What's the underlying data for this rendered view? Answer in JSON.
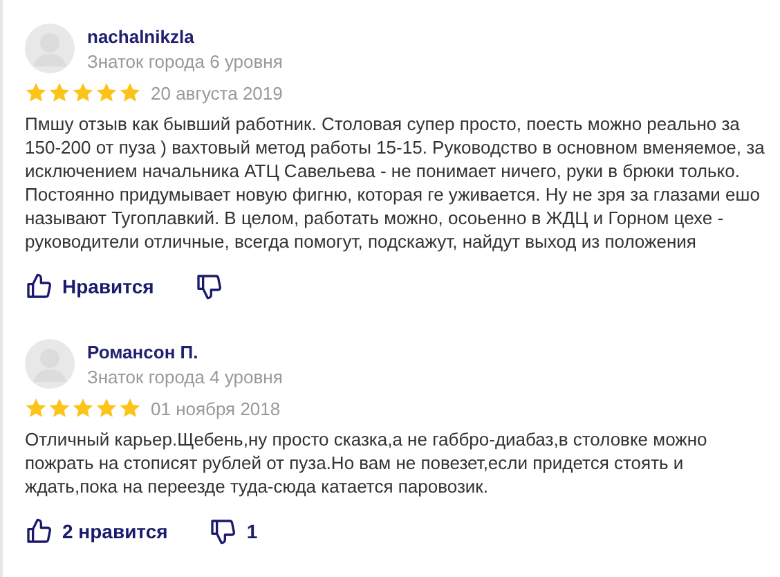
{
  "reviews": [
    {
      "author": "nachalnikzla",
      "level": "Знаток города 6 уровня",
      "stars": 5,
      "date": "20 августа 2019",
      "text": "Пмшу отзыв как бывший работник. Столовая супер просто, поесть можно реально за 150-200 от пуза ) вахтовый метод работы 15-15. Руководство в основном вменяемое, за исключением начальника АТЦ Савельева - не понимает ничего, руки в брюки только. Постоянно придумывает новую фигню, которая ге уживается. Ну не зря за глазами ешо называют Тугоплавкий. В целом, работать можно, осоьенно в ЖДЦ и Горном цехе - руководители отличные, всегда помогут, подскажут, найдут выход из положения",
      "like": "Нравится"
    },
    {
      "author": "Романсон П.",
      "level": "Знаток города 4 уровня",
      "stars": 5,
      "date": "01 ноября 2018",
      "text": "Отличный карьер.Щебень,ну просто сказка,а не габбро-диабаз,в столовке можно пожрать на стописят рублей от пуза.Но вам не повезет,если придется стоять и ждать,пока на переезде туда-сюда катается паровозик.",
      "like": "2 нравится",
      "dislike": "1"
    }
  ]
}
